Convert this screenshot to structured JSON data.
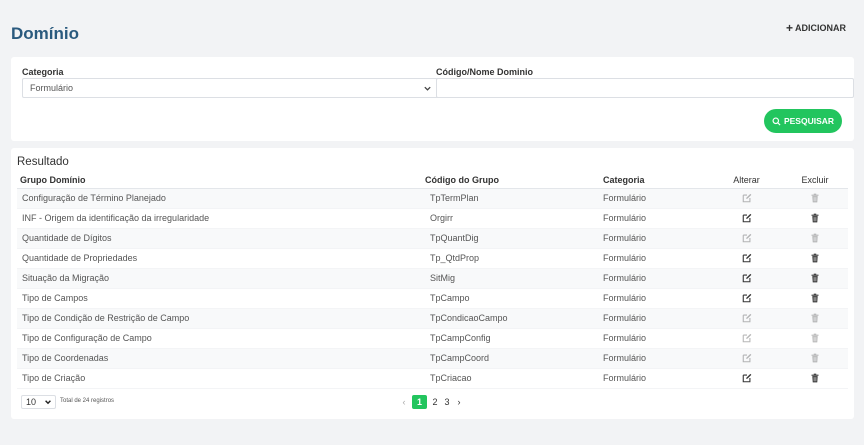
{
  "header": {
    "title": "Domínio",
    "add_label": "ADICIONAR"
  },
  "filter": {
    "category_label": "Categoria",
    "category_value": "Formulário",
    "code_label": "Código/Nome Dominio",
    "code_value": "",
    "search_label": "PESQUISAR"
  },
  "results": {
    "title": "Resultado",
    "columns": {
      "group": "Grupo Domínio",
      "code": "Código do Grupo",
      "category": "Categoria",
      "edit": "Alterar",
      "delete": "Excluir"
    },
    "rows": [
      {
        "group": "Configuração de Término Planejado",
        "code": "TpTermPlan",
        "category": "Formulário",
        "enabled": false
      },
      {
        "group": "INF - Origem da identificação da irregularidade",
        "code": "Orgirr",
        "category": "Formulário",
        "enabled": true
      },
      {
        "group": "Quantidade de Dígitos",
        "code": "TpQuantDig",
        "category": "Formulário",
        "enabled": false
      },
      {
        "group": "Quantidade de Propriedades",
        "code": "Tp_QtdProp",
        "category": "Formulário",
        "enabled": true
      },
      {
        "group": "Situação da Migração",
        "code": "SitMig",
        "category": "Formulário",
        "enabled": true
      },
      {
        "group": "Tipo de Campos",
        "code": "TpCampo",
        "category": "Formulário",
        "enabled": true
      },
      {
        "group": "Tipo de Condição de Restrição de Campo",
        "code": "TpCondicaoCampo",
        "category": "Formulário",
        "enabled": false
      },
      {
        "group": "Tipo de Configuração de Campo",
        "code": "TpCampConfig",
        "category": "Formulário",
        "enabled": false
      },
      {
        "group": "Tipo de Coordenadas",
        "code": "TpCampCoord",
        "category": "Formulário",
        "enabled": false
      },
      {
        "group": "Tipo de Criação",
        "code": "TpCriacao",
        "category": "Formulário",
        "enabled": true
      }
    ]
  },
  "pagination": {
    "per_page": "10",
    "total_text": "Total de 24 registros",
    "prev": "‹",
    "pages": [
      "1",
      "2",
      "3"
    ],
    "current": "1",
    "next": "›"
  },
  "colors": {
    "accent": "#22c55e",
    "title": "#2a5a7e"
  }
}
